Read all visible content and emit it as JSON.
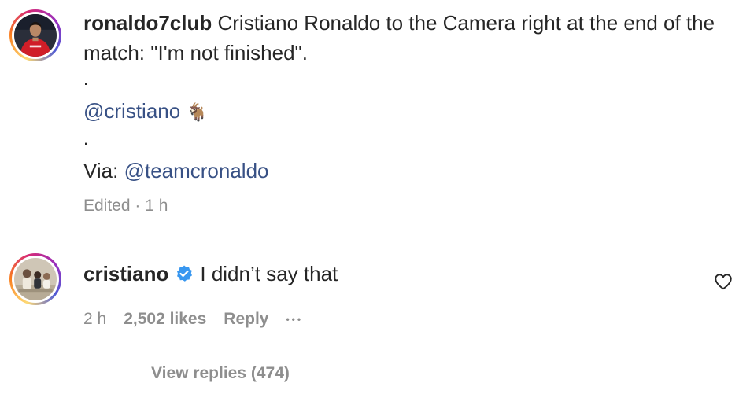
{
  "post": {
    "username": "ronaldo7club",
    "caption_text": "Cristiano Ronaldo to the Camera right at the end of the match: \"I'm not finished\".",
    "dot1": ".",
    "mention1": "@cristiano",
    "goat_emoji": "🐐",
    "dot2": ".",
    "via_label": "Via:",
    "mention2": "@teamcronaldo",
    "meta": "Edited · 1 h"
  },
  "comment": {
    "username": "cristiano",
    "verified_icon": "verified-badge-icon",
    "text": "I didn’t say that",
    "time": "2 h",
    "likes": "2,502 likes",
    "reply_label": "Reply",
    "more": "•••",
    "view_replies": "View replies (474)"
  },
  "colors": {
    "link": "#385185",
    "muted": "#8e8e8e",
    "verified": "#3897f0"
  }
}
